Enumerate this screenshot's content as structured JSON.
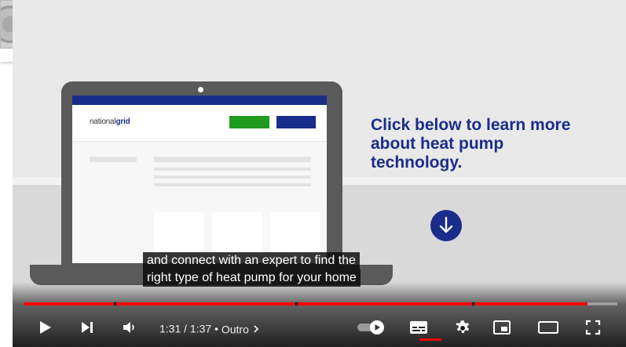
{
  "frame": {
    "brand_prefix": "national",
    "brand_suffix": "grid",
    "cta_text": "Click below to learn more about heat pump technology."
  },
  "captions": {
    "line1": "and connect with an expert to find the",
    "line2": "right type of heat pump for your home"
  },
  "player": {
    "current_time": "1:31",
    "separator": "/",
    "duration": "1:37",
    "chapter": "Outro",
    "progress_fraction": 0.95,
    "buffered_fraction": 1.0,
    "icons": {
      "play": "play-icon",
      "next": "next-icon",
      "volume": "volume-icon",
      "autoplay": "autoplay-toggle-icon",
      "subtitles": "subtitles-icon",
      "settings": "gear-icon",
      "miniplayer": "miniplayer-icon",
      "theater": "theater-mode-icon",
      "fullscreen": "fullscreen-icon"
    },
    "colors": {
      "progress": "#ff0000",
      "brand_blue": "#1a2d8a",
      "brand_green": "#1f9b1f"
    }
  }
}
